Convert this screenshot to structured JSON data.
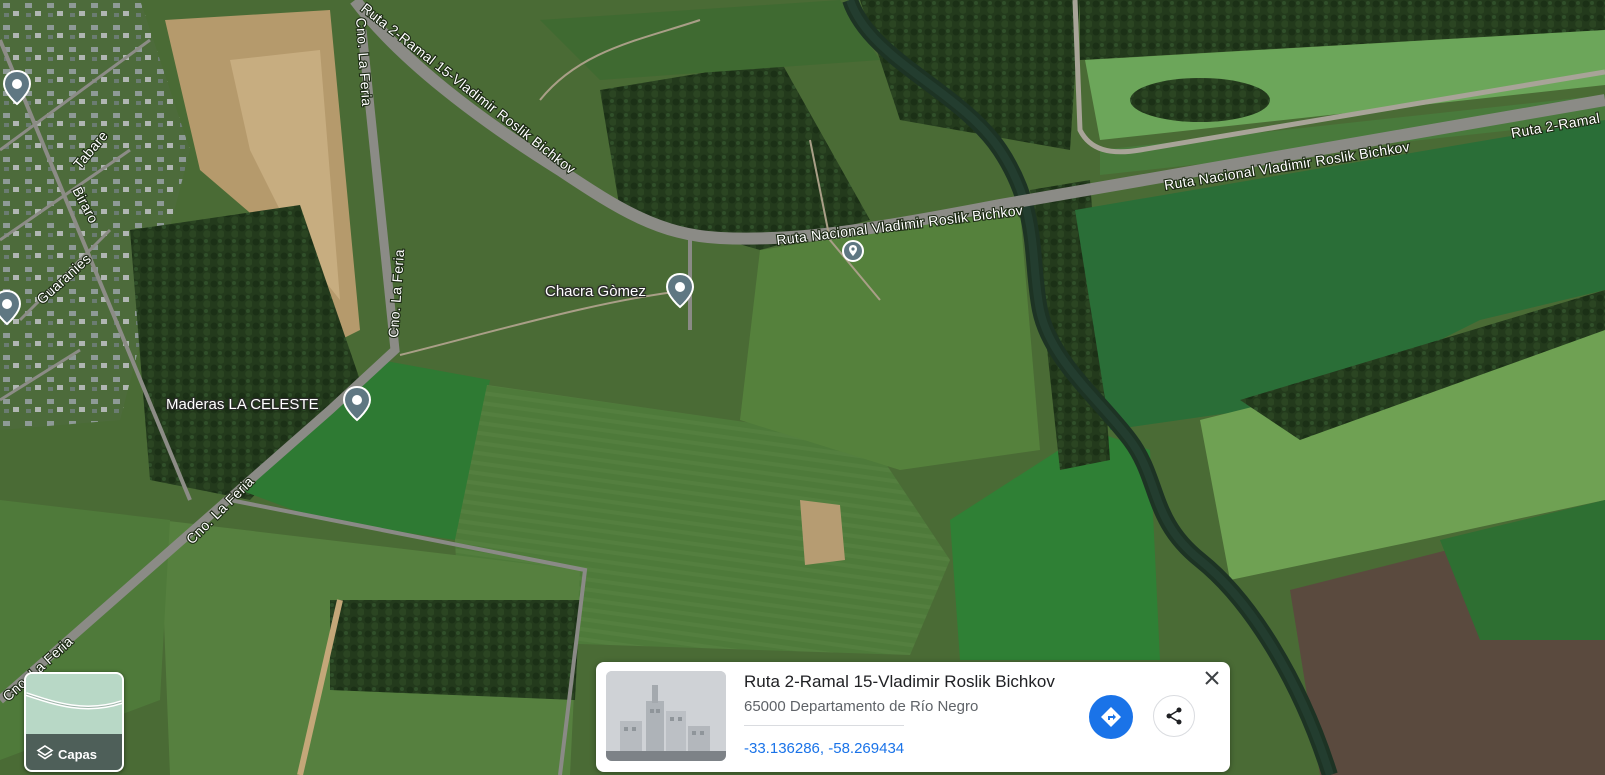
{
  "map": {
    "view": "satellite",
    "road_labels": {
      "ruta_ramal_diag": "Ruta 2-Ramal 15-Vladimir Roslik Bichkov",
      "ruta_nacional_1": "Ruta Nacional Vladimir Roslik Bichkov",
      "ruta_nacional_2": "Ruta Nacional Vladimir Roslik Bichkov",
      "ruta_2_right": "Ruta 2-Ramal",
      "cno_la_feria_1": "Cno. La Feria",
      "cno_la_feria_2": "Cno. La Feria",
      "cno_la_feria_3": "Cno. La Feria",
      "cno_la_feria_4": "Cno. La Feria",
      "tabare": "Tabare",
      "biraro": "Biraro",
      "guaranies": "Guaranies"
    },
    "places": {
      "chacra_gomez": "Chacra Gòmez",
      "maderas": "Maderas LA CELESTE"
    },
    "colors": {
      "pin_fill": "#5f7782",
      "road": "#8a8a8a",
      "field_green": "#2f7d3a"
    }
  },
  "info_card": {
    "title": "Ruta 2-Ramal 15-Vladimir Roslik Bichkov",
    "subtitle": "65000 Departamento de Río Negro",
    "coordinates": "-33.136286, -58.269434",
    "close_icon": "close-icon",
    "directions_icon": "directions-icon",
    "share_icon": "share-icon",
    "accent_color": "#1a73e8"
  },
  "layers_button": {
    "label": "Capas",
    "icon": "layers-icon"
  }
}
